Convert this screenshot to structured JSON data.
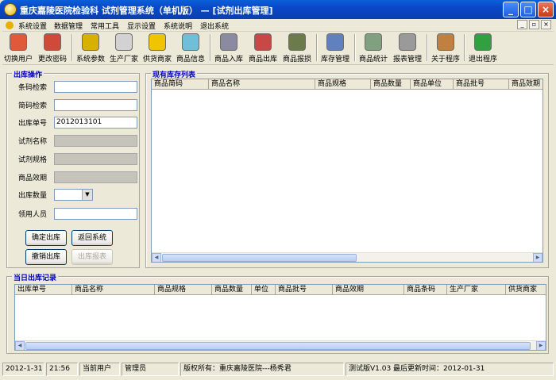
{
  "window": {
    "title": "重庆嘉陵医院检验科  试剂管理系统（单机版）  —  [试剂出库管理]"
  },
  "menu": [
    "系统设置",
    "数据管理",
    "常用工具",
    "显示设置",
    "系统说明",
    "退出系统"
  ],
  "toolbar": [
    {
      "label": "切换用户",
      "icon": "switch-user-icon",
      "color": "#e05a3a"
    },
    {
      "label": "更改密码",
      "icon": "change-password-icon",
      "color": "#d04a3a"
    },
    {
      "label": "系统参数",
      "icon": "settings-icon",
      "color": "#d8b000"
    },
    {
      "label": "生产厂家",
      "icon": "factory-icon",
      "color": "#d2d2d2"
    },
    {
      "label": "供货商家",
      "icon": "supplier-truck-icon",
      "color": "#f0c400"
    },
    {
      "label": "商品信息",
      "icon": "product-flask-icon",
      "color": "#6fbfd8"
    },
    {
      "label": "商品入库",
      "icon": "inbound-icon",
      "color": "#8a8aa0"
    },
    {
      "label": "商品出库",
      "icon": "outbound-icon",
      "color": "#c84848"
    },
    {
      "label": "商品报损",
      "icon": "damage-report-icon",
      "color": "#6b7b4b"
    },
    {
      "label": "库存管理",
      "icon": "inventory-icon",
      "color": "#6080c0"
    },
    {
      "label": "商品统计",
      "icon": "statistics-icon",
      "color": "#80a080"
    },
    {
      "label": "报表管理",
      "icon": "report-icon",
      "color": "#9a9a9a"
    },
    {
      "label": "关于程序",
      "icon": "about-icon",
      "color": "#c08040"
    },
    {
      "label": "退出程序",
      "icon": "exit-icon",
      "color": "#30a040"
    }
  ],
  "outbound_panel": {
    "legend": "出库操作",
    "fields": {
      "barcode": {
        "label": "条码检索",
        "value": ""
      },
      "shortcode": {
        "label": "简码检索",
        "value": ""
      },
      "order_no": {
        "label": "出库单号",
        "value": "2012013101"
      },
      "reagent_name": {
        "label": "试剂名称",
        "value": ""
      },
      "reagent_spec": {
        "label": "试剂规格",
        "value": ""
      },
      "expiry": {
        "label": "商品效期",
        "value": ""
      },
      "quantity": {
        "label": "出库数量",
        "value": ""
      },
      "receiver": {
        "label": "领用人员",
        "value": ""
      }
    },
    "buttons": {
      "confirm": "确定出库",
      "back": "返回系统",
      "undo": "撤销出库",
      "report": "出库报表"
    }
  },
  "stock_list": {
    "legend": "现有库存列表",
    "columns": [
      "商品简码",
      "商品名称",
      "商品规格",
      "商品数量",
      "商品单位",
      "商品批号",
      "商品效期"
    ]
  },
  "today_records": {
    "legend": "当日出库记录",
    "columns": [
      "出库单号",
      "商品名称",
      "商品规格",
      "商品数量",
      "单位",
      "商品批号",
      "商品效期",
      "商品条码",
      "生产厂家",
      "供货商家"
    ]
  },
  "status": {
    "date": "2012-1-31",
    "time": "21:56",
    "user_label": "当前用户",
    "user": "管理员",
    "copyright": "版权所有：重庆嘉陵医院---杨秀君",
    "version": "测试版V1.03  最后更新时间：2012-01-31"
  }
}
